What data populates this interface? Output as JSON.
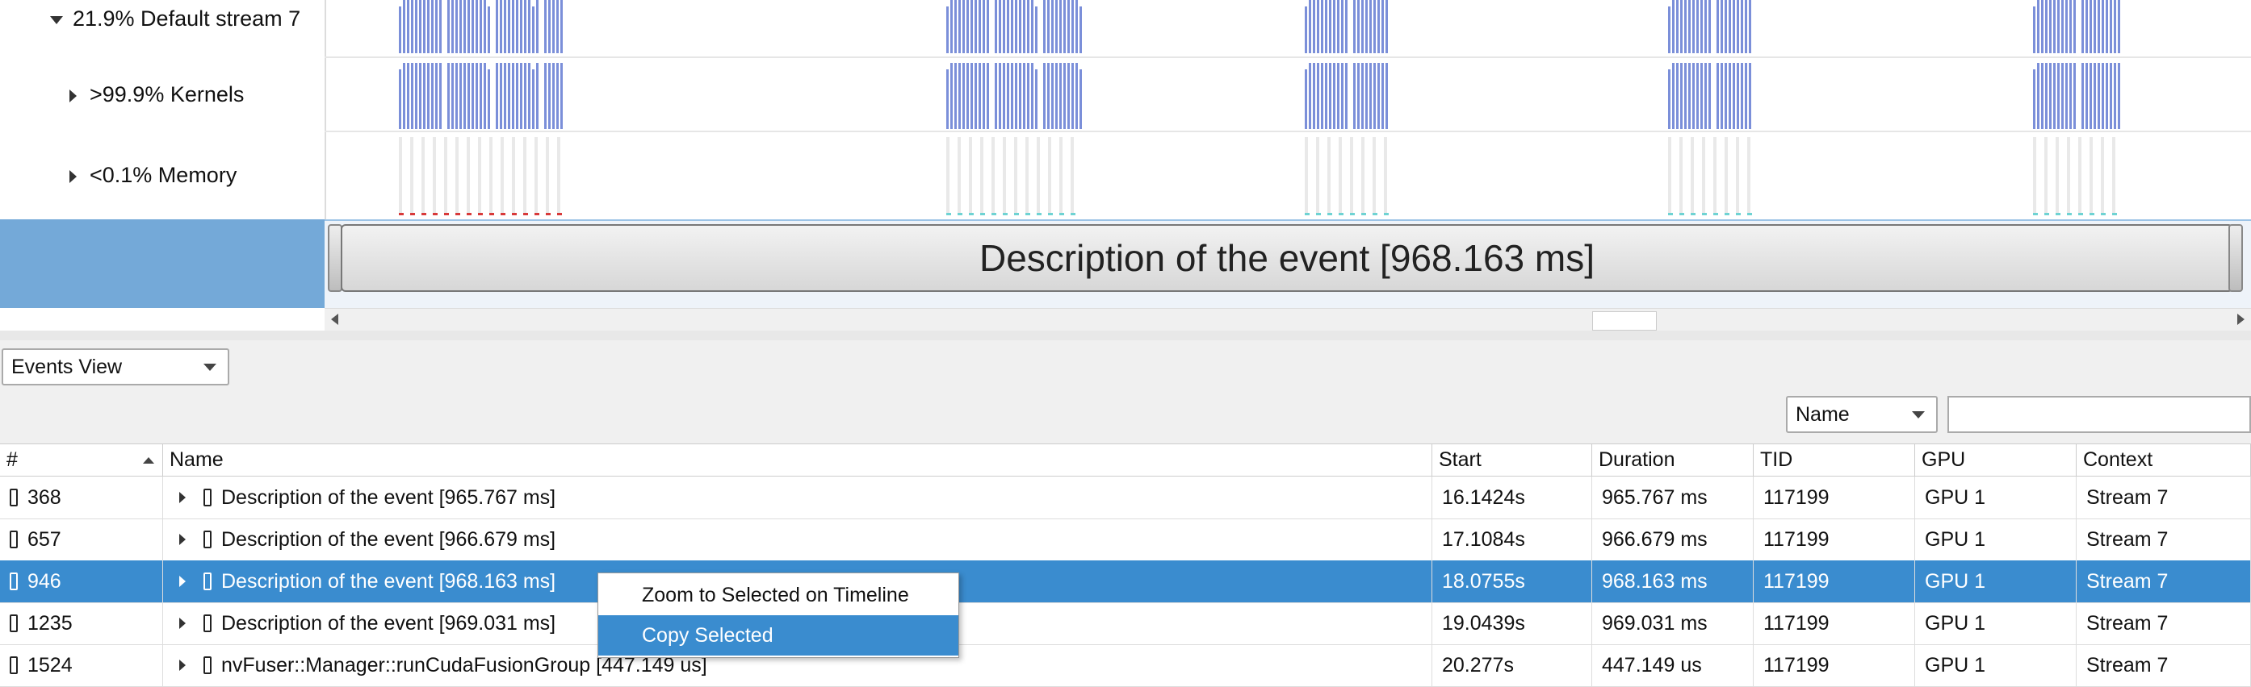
{
  "timeline": {
    "rows": [
      {
        "label": "21.9% Default stream 7",
        "expanded": true
      },
      {
        "label": ">99.9% Kernels",
        "expanded": false
      },
      {
        "label": "<0.1% Memory",
        "expanded": false
      }
    ],
    "selected_event": "Description of the event [968.163 ms]",
    "colors": {
      "kernel_bar": "#7b8fd9",
      "selection_band": "#74a9d8",
      "memory_red": "#d83a3a",
      "memory_cyan": "#6fd3d3"
    }
  },
  "events_panel": {
    "view_selector": "Events View",
    "filter_field": "Name",
    "search_value": "",
    "columns": [
      "#",
      "Name",
      "Start",
      "Duration",
      "TID",
      "GPU",
      "Context"
    ],
    "rows": [
      {
        "id": "368",
        "name": "Description of the event [965.767 ms]",
        "start": "16.1424s",
        "duration": "965.767 ms",
        "tid": "117199",
        "gpu": "GPU 1",
        "context": "Stream 7",
        "selected": false
      },
      {
        "id": "657",
        "name": "Description of the event [966.679 ms]",
        "start": "17.1084s",
        "duration": "966.679 ms",
        "tid": "117199",
        "gpu": "GPU 1",
        "context": "Stream 7",
        "selected": false
      },
      {
        "id": "946",
        "name": "Description of the event [968.163 ms]",
        "start": "18.0755s",
        "duration": "968.163 ms",
        "tid": "117199",
        "gpu": "GPU 1",
        "context": "Stream 7",
        "selected": true
      },
      {
        "id": "1235",
        "name": "Description of the event [969.031 ms]",
        "start": "19.0439s",
        "duration": "969.031 ms",
        "tid": "117199",
        "gpu": "GPU 1",
        "context": "Stream 7",
        "selected": false
      },
      {
        "id": "1524",
        "name": "nvFuser::Manager::runCudaFusionGroup [447.149 us]",
        "start": "20.277s",
        "duration": "447.149 us",
        "tid": "117199",
        "gpu": "GPU 1",
        "context": "Stream 7",
        "selected": false
      }
    ]
  },
  "context_menu": {
    "items": [
      {
        "label": "Zoom to Selected on Timeline",
        "highlighted": false
      },
      {
        "label": "Copy Selected",
        "highlighted": true
      }
    ]
  }
}
